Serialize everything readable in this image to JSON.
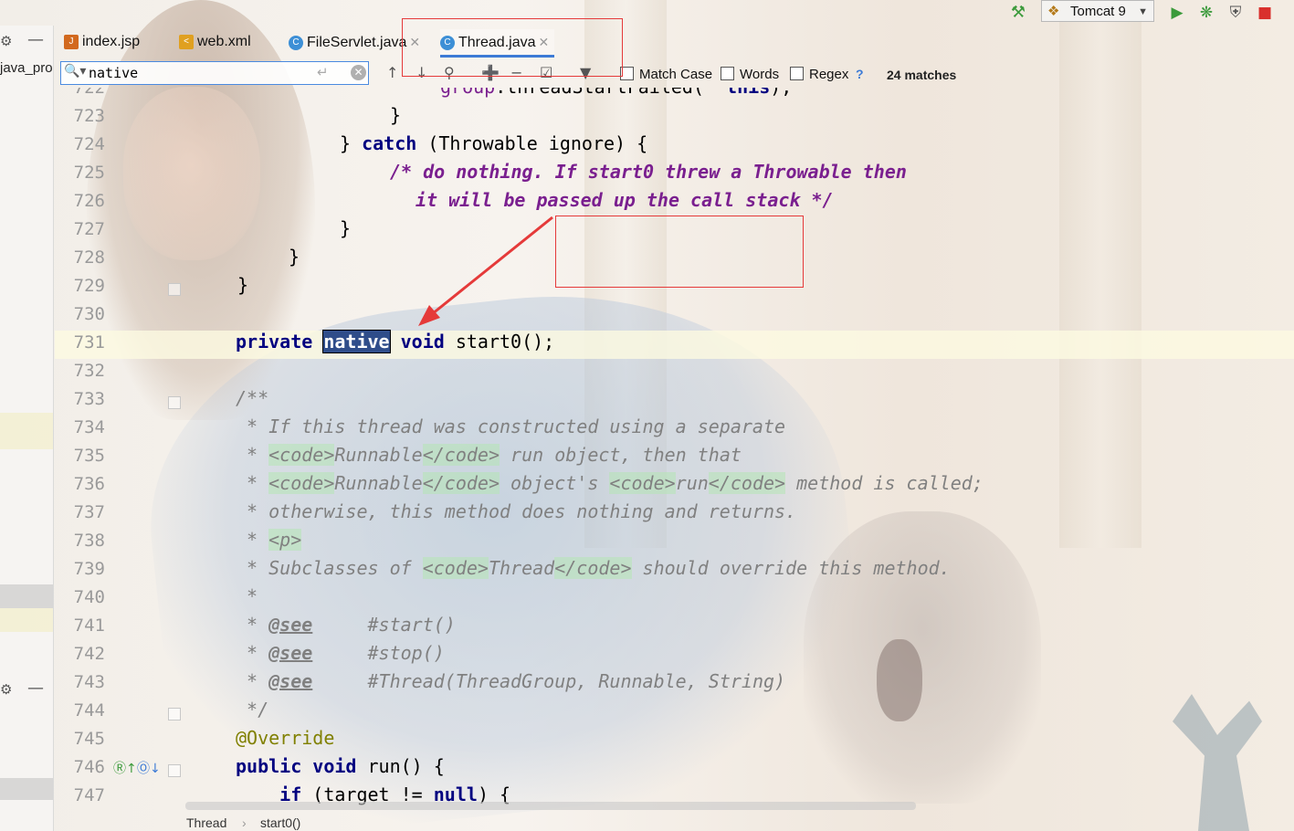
{
  "toolbar": {
    "run_config_label": "Tomcat 9",
    "colors": {
      "run": "#3b9a3b",
      "debug": "#3b9a3b",
      "stop": "#d9302c"
    }
  },
  "left_panel": {
    "project_label": "java_pro"
  },
  "tabs": [
    {
      "label": "index.jsp",
      "icon": "jsp-file-icon",
      "active": false,
      "closable": false
    },
    {
      "label": "web.xml",
      "icon": "xml-file-icon",
      "active": false,
      "closable": false
    },
    {
      "label": "FileServlet.java",
      "icon": "java-class-icon",
      "active": false,
      "closable": true
    },
    {
      "label": "Thread.java",
      "icon": "java-class-icon",
      "active": true,
      "closable": true
    }
  ],
  "search": {
    "query": "native",
    "options": [
      {
        "label": "Match Case",
        "checked": false
      },
      {
        "label": "Words",
        "checked": false
      },
      {
        "label": "Regex",
        "checked": false
      }
    ],
    "help": "?",
    "matches_text": "24 matches"
  },
  "editor": {
    "lines": [
      {
        "num": "722",
        "code": "        group.threadStartFailed(  this);"
      },
      {
        "num": "723",
        "code": "        }"
      },
      {
        "num": "724",
        "code": "} catch (Throwable ignore) {"
      },
      {
        "num": "725",
        "code": "/* do nothing. If start0 threw a Throwable then"
      },
      {
        "num": "726",
        "code": "it will be passed up the call stack */"
      },
      {
        "num": "727",
        "code": "}"
      },
      {
        "num": "728",
        "code": "}"
      },
      {
        "num": "729",
        "code": "}"
      },
      {
        "num": "730",
        "code": ""
      },
      {
        "num": "731",
        "code": "private native void start0();"
      },
      {
        "num": "732",
        "code": ""
      },
      {
        "num": "733",
        "code": "/**"
      },
      {
        "num": "734",
        "code": " * If this thread was constructed using a separate"
      },
      {
        "num": "735",
        "code": " * <code>Runnable</code> run object, then that"
      },
      {
        "num": "736",
        "code": " * <code>Runnable</code> object's <code>run</code> method is called;"
      },
      {
        "num": "737",
        "code": " * otherwise, this method does nothing and returns."
      },
      {
        "num": "738",
        "code": " * <p>"
      },
      {
        "num": "739",
        "code": " * Subclasses of <code>Thread</code> should override this method."
      },
      {
        "num": "740",
        "code": " *"
      },
      {
        "num": "741",
        "code": " * @see     #start()"
      },
      {
        "num": "742",
        "code": " * @see     #stop()"
      },
      {
        "num": "743",
        "code": " * @see     #Thread(ThreadGroup, Runnable, String)"
      },
      {
        "num": "744",
        "code": " */"
      },
      {
        "num": "745",
        "code": "@Override"
      },
      {
        "num": "746",
        "code": "public void run() {"
      },
      {
        "num": "747",
        "code": "    if (target != null) {"
      }
    ]
  },
  "breadcrumb": {
    "items": [
      "Thread",
      "start0()"
    ]
  }
}
